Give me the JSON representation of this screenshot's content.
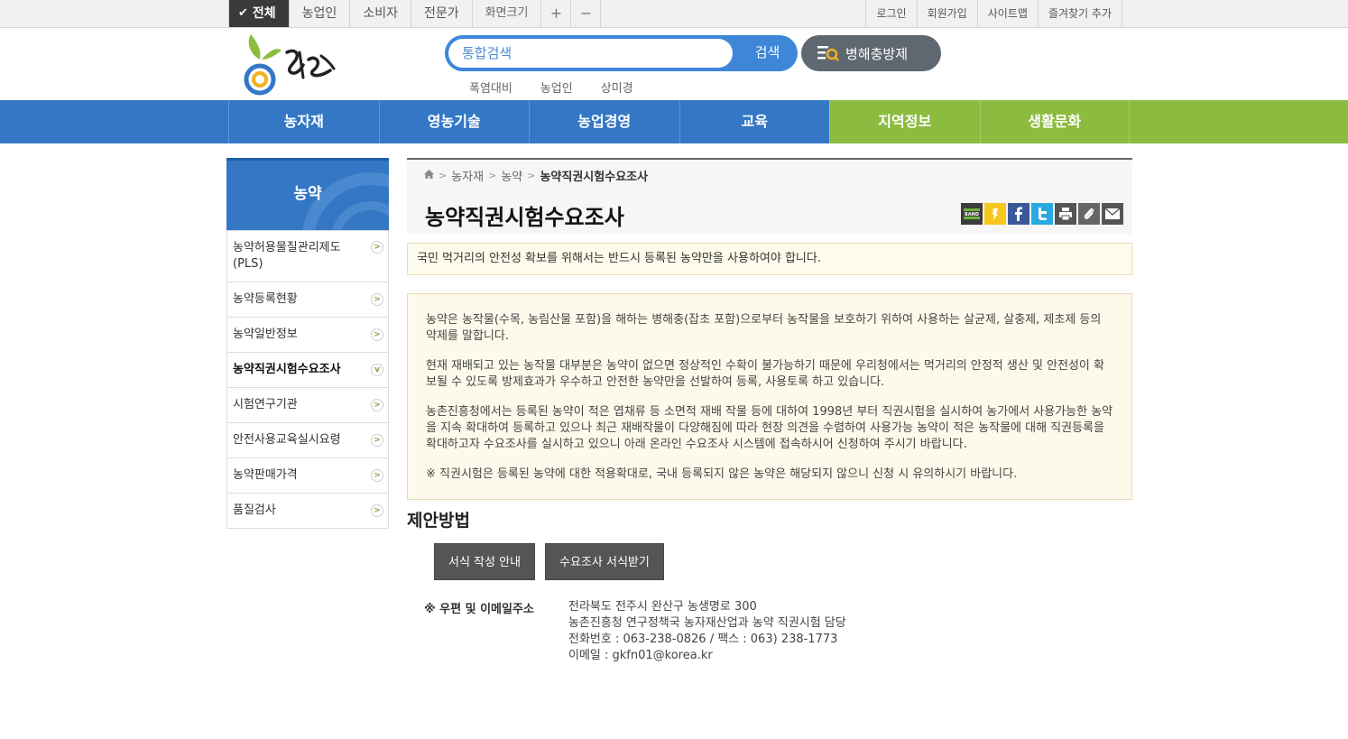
{
  "topbar": {
    "tabs": [
      {
        "label": "전체",
        "icon": "check-icon",
        "active": true
      },
      {
        "label": "농업인"
      },
      {
        "label": "소비자"
      },
      {
        "label": "전문가"
      }
    ],
    "font_size_label": "화면크기",
    "zoom_in": "+",
    "zoom_out": "−",
    "util_links": [
      "로그인",
      "회원가입",
      "사이트맵",
      "즐겨찾기 추가"
    ]
  },
  "header": {
    "logo_text": "농사로",
    "search_placeholder": "통합검색",
    "search_button": "검색",
    "pest_button": "병해충방제",
    "keywords": [
      "폭염대비",
      "농업인",
      "상미경"
    ]
  },
  "gnb": {
    "items": [
      "농자재",
      "영농기술",
      "농업경영",
      "교육",
      "지역정보",
      "생활문화"
    ]
  },
  "colors": {
    "blue": "#3477c4",
    "green": "#8cbc3f",
    "search_blue": "#3d86d8",
    "notice_bg": "#fdfbeb"
  },
  "lnb": {
    "title": "농약",
    "items": [
      {
        "label": "농약허용물질관리제도(PLS)"
      },
      {
        "label": "농약등록현황"
      },
      {
        "label": "농약일반정보"
      },
      {
        "label": "농약직권시험수요조사",
        "active": true
      },
      {
        "label": "시험연구기관"
      },
      {
        "label": "안전사용교육실시요령"
      },
      {
        "label": "농약판매가격"
      },
      {
        "label": "품질검사"
      }
    ]
  },
  "breadcrumb": [
    "농자재",
    "농약",
    "농약직권시험수요조사"
  ],
  "page_title": "농약직권시험수요조사",
  "share_icons": [
    "band-icon",
    "kakaostory-icon",
    "facebook-icon",
    "twitter-icon",
    "print-icon",
    "clip-icon",
    "mail-icon"
  ],
  "notice": "국민 먹거리의 안전성 확보를 위해서는 반드시 등록된 농약만을 사용하여야 합니다.",
  "description": [
    "농약은 농작물(수목, 농림산물 포함)을 해하는 병해충(잡초 포함)으로부터 농작물을 보호하기 위하여 사용하는 살균제, 살충제, 제초제 등의 약제를 말합니다.",
    "현재 재배되고 있는 농작물 대부분은 농약이 없으면 정상적인 수확이 불가능하기 때문에 우리청에서는 먹거리의 안정적 생산 및 안전성이 확보될 수 있도록 방제효과가 우수하고 안전한 농약만을 선발하여 등록, 사용토록 하고 있습니다.",
    "농촌진흥청에서는 등록된 농약이 적은 엽채류 등 소면적 재배 작물 등에 대하여 1998년 부터 직권시험을 실시하여 농가에서 사용가능한 농약을 지속 확대하여 등록하고 있으나 최근 재배작물이 다양해짐에 따라 현장 의견을 수렴하여 사용가능 농약이 적은 농작물에 대해 직권등록을 확대하고자 수요조사를 실시하고 있으니 아래 온라인 수요조사 시스템에 접속하시어 신청하여 주시기 바랍니다.",
    "※ 직권시험은 등록된 농약에 대한 적용확대로, 국내 등록되지 않은 농약은 해당되지 않으니 신청 시 유의하시기 바랍니다."
  ],
  "method": {
    "title": "제안방법",
    "buttons": [
      "서식 작성 안내",
      "수요조사 서식받기"
    ]
  },
  "contact": {
    "label": "※ 우편 및 이메일주소",
    "lines": [
      "전라북도 전주시 완산구 농생명로 300",
      "농촌진흥청 연구정책국 농자재산업과 농약 직권시험 담당",
      "전화번호 : 063-238-0826 / 팩스 : 063) 238-1773",
      "이메일 : gkfn01@korea.kr"
    ]
  }
}
